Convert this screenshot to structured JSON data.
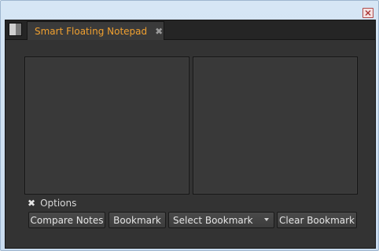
{
  "window": {
    "close_icon": "close-icon"
  },
  "tab": {
    "title": "Smart Floating Notepad",
    "close_glyph": "✖"
  },
  "options": {
    "glyph": "✖",
    "label": "Options"
  },
  "buttons": {
    "compare": "Compare Notes",
    "bookmark": "Bookmark",
    "select_bookmark": "Select Bookmark",
    "clear_bookmark": "Clear Bookmark"
  },
  "colors": {
    "tab_accent": "#f0a030",
    "panel_bg": "#333333"
  }
}
